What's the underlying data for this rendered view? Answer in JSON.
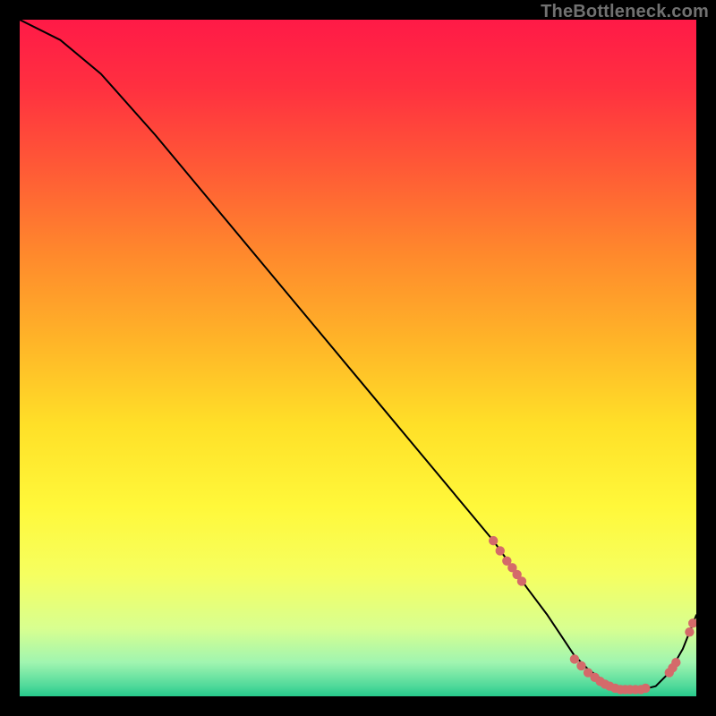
{
  "watermark": "TheBottleneck.com",
  "chart_data": {
    "type": "line",
    "title": "",
    "xlabel": "",
    "ylabel": "",
    "xlim": [
      0,
      100
    ],
    "ylim": [
      0,
      100
    ],
    "curve": {
      "x": [
        0,
        6,
        12,
        20,
        30,
        40,
        50,
        60,
        70,
        75,
        78,
        80,
        82,
        84,
        86,
        88,
        90,
        92,
        94,
        96,
        98,
        100
      ],
      "y": [
        100,
        97,
        92,
        83,
        71,
        59,
        47,
        35,
        23,
        16,
        12,
        9,
        6,
        4,
        2.5,
        1.5,
        1,
        1,
        1.5,
        3.5,
        7,
        12
      ]
    },
    "markers": [
      {
        "x": 70.0,
        "y": 23.0
      },
      {
        "x": 71.0,
        "y": 21.5
      },
      {
        "x": 72.0,
        "y": 20.0
      },
      {
        "x": 72.8,
        "y": 19.0
      },
      {
        "x": 73.5,
        "y": 18.0
      },
      {
        "x": 74.2,
        "y": 17.0
      },
      {
        "x": 82.0,
        "y": 5.5
      },
      {
        "x": 83.0,
        "y": 4.5
      },
      {
        "x": 84.0,
        "y": 3.5
      },
      {
        "x": 85.0,
        "y": 2.8
      },
      {
        "x": 85.8,
        "y": 2.2
      },
      {
        "x": 86.5,
        "y": 1.8
      },
      {
        "x": 87.2,
        "y": 1.5
      },
      {
        "x": 88.0,
        "y": 1.2
      },
      {
        "x": 88.8,
        "y": 1.0
      },
      {
        "x": 89.5,
        "y": 1.0
      },
      {
        "x": 90.2,
        "y": 1.0
      },
      {
        "x": 91.0,
        "y": 1.0
      },
      {
        "x": 91.8,
        "y": 1.0
      },
      {
        "x": 92.5,
        "y": 1.2
      },
      {
        "x": 96.0,
        "y": 3.5
      },
      {
        "x": 96.5,
        "y": 4.2
      },
      {
        "x": 97.0,
        "y": 5.0
      },
      {
        "x": 99.0,
        "y": 9.5
      },
      {
        "x": 99.5,
        "y": 10.8
      }
    ],
    "gradient_stops": [
      {
        "offset": 0.0,
        "color": "#ff1a47"
      },
      {
        "offset": 0.1,
        "color": "#ff3040"
      },
      {
        "offset": 0.22,
        "color": "#ff5a36"
      },
      {
        "offset": 0.35,
        "color": "#ff8a2c"
      },
      {
        "offset": 0.48,
        "color": "#ffb628"
      },
      {
        "offset": 0.6,
        "color": "#ffe028"
      },
      {
        "offset": 0.72,
        "color": "#fff83a"
      },
      {
        "offset": 0.82,
        "color": "#f6ff60"
      },
      {
        "offset": 0.9,
        "color": "#d8ff90"
      },
      {
        "offset": 0.95,
        "color": "#a0f5b0"
      },
      {
        "offset": 0.985,
        "color": "#4fd99a"
      },
      {
        "offset": 1.0,
        "color": "#26c98b"
      }
    ],
    "marker_color": "#d46a6a",
    "curve_color": "#000000"
  }
}
